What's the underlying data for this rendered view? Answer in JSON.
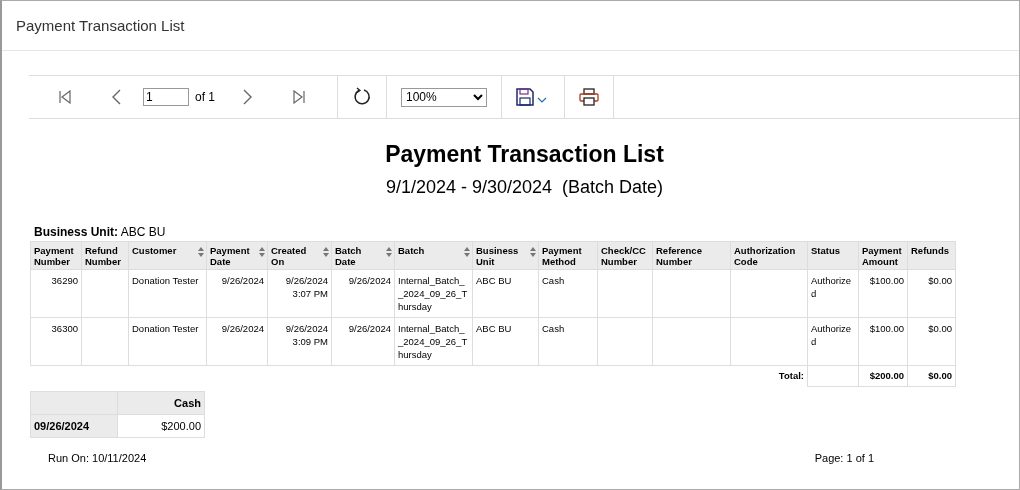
{
  "window": {
    "title": "Payment Transaction List"
  },
  "toolbar": {
    "page": "1",
    "page_count": "of 1",
    "zoom": "100%"
  },
  "report": {
    "title": "Payment Transaction List",
    "subtitle": "9/1/2024 - 9/30/2024  (Batch Date)",
    "group_label": "Business Unit:",
    "group_value": "ABC BU",
    "columns": [
      {
        "label": "Payment Number",
        "sortable": false
      },
      {
        "label": "Refund Number",
        "sortable": false
      },
      {
        "label": "Customer",
        "sortable": true
      },
      {
        "label": "Payment Date",
        "sortable": true
      },
      {
        "label": "Created On",
        "sortable": true
      },
      {
        "label": "Batch Date",
        "sortable": true
      },
      {
        "label": "Batch",
        "sortable": true
      },
      {
        "label": "Business Unit",
        "sortable": true
      },
      {
        "label": "Payment Method",
        "sortable": false
      },
      {
        "label": "Check/CC Number",
        "sortable": false
      },
      {
        "label": "Reference Number",
        "sortable": false
      },
      {
        "label": "Authorization Code",
        "sortable": false
      },
      {
        "label": "Status",
        "sortable": false
      },
      {
        "label": "Payment Amount",
        "sortable": false
      },
      {
        "label": "Refunds",
        "sortable": false
      }
    ],
    "rows": [
      {
        "cells": [
          "36290",
          null,
          "Donation Tester",
          "9/26/2024",
          "9/26/2024 3:07 PM",
          "9/26/2024",
          "Internal_Batch__2024_09_26_Thursday",
          "ABC BU",
          "Cash",
          null,
          null,
          null,
          "Authorized",
          "$100.00",
          "$0.00"
        ]
      },
      {
        "cells": [
          "36300",
          null,
          "Donation Tester",
          "9/26/2024",
          "9/26/2024 3:09 PM",
          "9/26/2024",
          "Internal_Batch__2024_09_26_Thursday",
          "ABC BU",
          "Cash",
          null,
          null,
          null,
          "Authorized",
          "$100.00",
          "$0.00"
        ]
      }
    ],
    "total": {
      "label": "Total:",
      "payment_amount": "$200.00",
      "refunds": "$0.00"
    },
    "summary": {
      "column": "Cash",
      "rows": [
        {
          "date": "09/26/2024",
          "amount": "$200.00"
        }
      ]
    },
    "footer": {
      "run_on": "Run On:  10/11/2024",
      "page": "Page: 1 of 1"
    }
  }
}
